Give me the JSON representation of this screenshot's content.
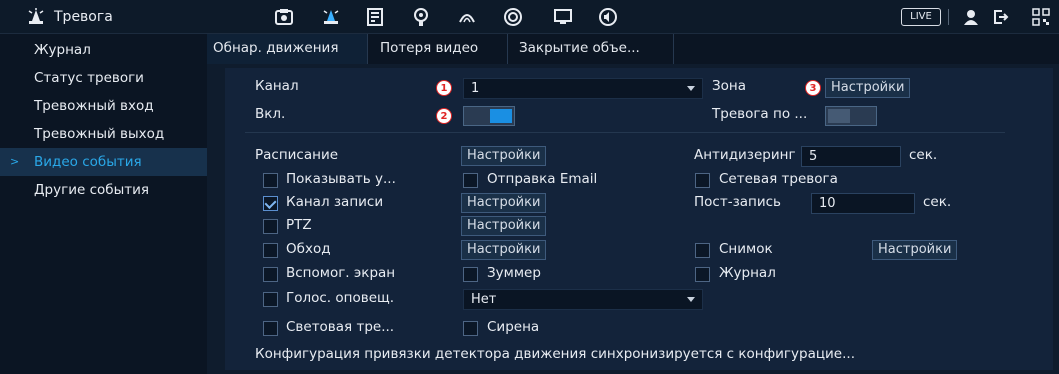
{
  "app": {
    "title": "Тревога",
    "live_label": "LIVE"
  },
  "topbar": {
    "icons": [
      "camera-icon",
      "alarm-icon",
      "storage-icon",
      "network-icon",
      "display-icon",
      "record-icon",
      "monitor-icon",
      "audio-icon"
    ],
    "right_icons": [
      "user-icon",
      "logout-icon",
      "qr-icon"
    ]
  },
  "sidebar": {
    "items": [
      {
        "label": "Журнал"
      },
      {
        "label": "Статус тревоги"
      },
      {
        "label": "Тревожный вход"
      },
      {
        "label": "Тревожный выход"
      },
      {
        "label": "Видео события",
        "active": true
      },
      {
        "label": "Другие события"
      }
    ]
  },
  "tabs": [
    {
      "label": "Обнар. движения",
      "active": true
    },
    {
      "label": "Потеря видео"
    },
    {
      "label": "Закрытие объе..."
    }
  ],
  "form": {
    "channel_label": "Канал",
    "channel_value": "1",
    "zone_label": "Зона",
    "zone_button": "Настройки",
    "enable_label": "Вкл.",
    "alarm_by_label": "Тревога по ...",
    "schedule_label": "Расписание",
    "schedule_button": "Настройки",
    "antidither_label": "Антидизеринг",
    "antidither_value": "5",
    "antidither_unit": "сек.",
    "show_msg_label": "Показывать у...",
    "send_email_label": "Отправка Email",
    "net_alarm_label": "Сетевая тревога",
    "record_channel_label": "Канал записи",
    "record_channel_button": "Настройки",
    "post_record_label": "Пост-запись",
    "post_record_value": "10",
    "post_record_unit": "сек.",
    "ptz_label": "PTZ",
    "ptz_button": "Настройки",
    "tour_label": "Обход",
    "tour_button": "Настройки",
    "snapshot_label": "Снимок",
    "snapshot_button": "Настройки",
    "aux_screen_label": "Вспомог. экран",
    "buzzer_label": "Зуммер",
    "log_label": "Журнал",
    "voice_label": "Голос. оповещ.",
    "voice_value": "Нет",
    "light_label": "Световая тре...",
    "siren_label": "Сирена",
    "footer_note": "Конфигурация привязки детектора движения синхронизируется с конфигурацие..."
  },
  "badges": [
    "1",
    "2",
    "3"
  ],
  "colors": {
    "accent": "#2aa8e8",
    "badge": "#e02525",
    "toggle_on": "#1a8fe3"
  }
}
